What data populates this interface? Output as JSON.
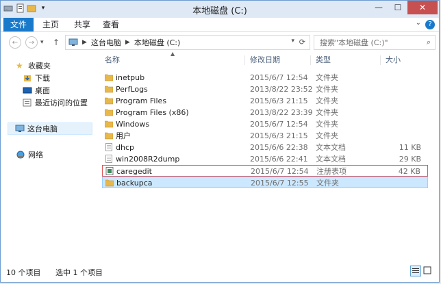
{
  "window": {
    "title": "本地磁盘 (C:)"
  },
  "ribbon": {
    "tabs": [
      "文件",
      "主页",
      "共享",
      "查看"
    ]
  },
  "addressbar": {
    "crumbs": [
      "这台电脑",
      "本地磁盘 (C:)"
    ]
  },
  "search": {
    "placeholder": "搜索\"本地磁盘 (C:)\""
  },
  "sidebar": {
    "favorites": "收藏夹",
    "favorite_items": [
      "下载",
      "桌面",
      "最近访问的位置"
    ],
    "this_pc": "这台电脑",
    "network": "网络"
  },
  "columns": {
    "name": "名称",
    "date": "修改日期",
    "type": "类型",
    "size": "大小"
  },
  "files": [
    {
      "name": "inetpub",
      "date": "2015/6/7 12:54",
      "type": "文件夹",
      "size": "",
      "icon": "folder-icon"
    },
    {
      "name": "PerfLogs",
      "date": "2013/8/22 23:52",
      "type": "文件夹",
      "size": "",
      "icon": "folder-icon"
    },
    {
      "name": "Program Files",
      "date": "2015/6/3 21:15",
      "type": "文件夹",
      "size": "",
      "icon": "folder-icon"
    },
    {
      "name": "Program Files (x86)",
      "date": "2013/8/22 23:39",
      "type": "文件夹",
      "size": "",
      "icon": "folder-icon"
    },
    {
      "name": "Windows",
      "date": "2015/6/7 12:54",
      "type": "文件夹",
      "size": "",
      "icon": "folder-icon"
    },
    {
      "name": "用户",
      "date": "2015/6/3 21:15",
      "type": "文件夹",
      "size": "",
      "icon": "folder-icon"
    },
    {
      "name": "dhcp",
      "date": "2015/6/6 22:38",
      "type": "文本文档",
      "size": "11 KB",
      "icon": "text-file-icon"
    },
    {
      "name": "win2008R2dump",
      "date": "2015/6/6 22:41",
      "type": "文本文档",
      "size": "29 KB",
      "icon": "text-file-icon"
    },
    {
      "name": "caregedit",
      "date": "2015/6/7 12:54",
      "type": "注册表项",
      "size": "42 KB",
      "icon": "registry-file-icon"
    },
    {
      "name": "backupca",
      "date": "2015/6/7 12:55",
      "type": "文件夹",
      "size": "",
      "icon": "folder-icon"
    }
  ],
  "status": {
    "count": "10 个项目",
    "selected": "选中 1 个项目"
  },
  "colors": {
    "accent": "#1979ca",
    "selection": "#cce8ff",
    "highlight_border": "#e05555",
    "folder": "#e8b84a"
  }
}
